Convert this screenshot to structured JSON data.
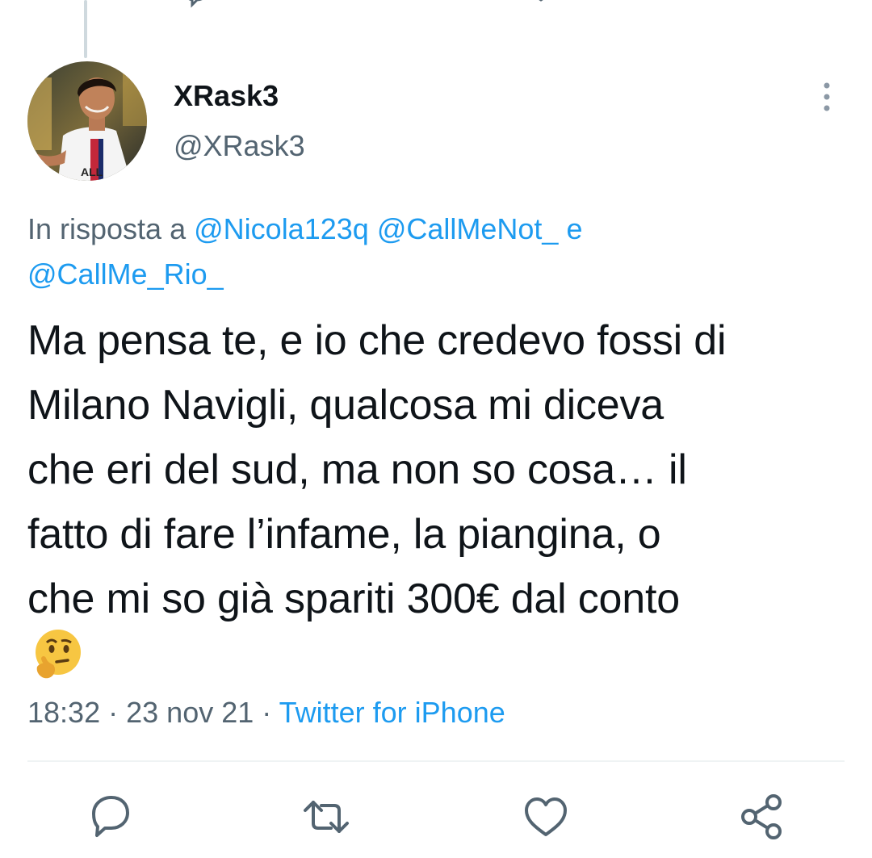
{
  "tweet": {
    "display_name": "XRask3",
    "handle": "@XRask3",
    "reply_prefix": "In risposta a",
    "reply_mentions": [
      "@Nicola123q",
      "@CallMeNot_",
      "@CallMe_Rio_"
    ],
    "reply_conjunction": "e",
    "text_lines": [
      "Ma pensa te, e io che credevo fossi di",
      "Milano Navigli, qualcosa mi diceva",
      "che eri del sud, ma non so cosa… il",
      "fatto di fare l’infame, la piangina, o",
      "che mi so già spariti 300€ dal conto"
    ],
    "emoji": "thinking-face",
    "time": "18:32",
    "date": "23 nov 21",
    "separator": "·",
    "source": "Twitter for iPhone"
  },
  "actions": [
    {
      "name": "reply",
      "icon": "reply-icon"
    },
    {
      "name": "retweet",
      "icon": "retweet-icon"
    },
    {
      "name": "like",
      "icon": "heart-icon"
    },
    {
      "name": "share",
      "icon": "share-icon"
    }
  ],
  "colors": {
    "accent": "#1d9bf0",
    "secondary_text": "#536471",
    "primary_text": "#0f1419",
    "divider": "#eff3f4"
  }
}
